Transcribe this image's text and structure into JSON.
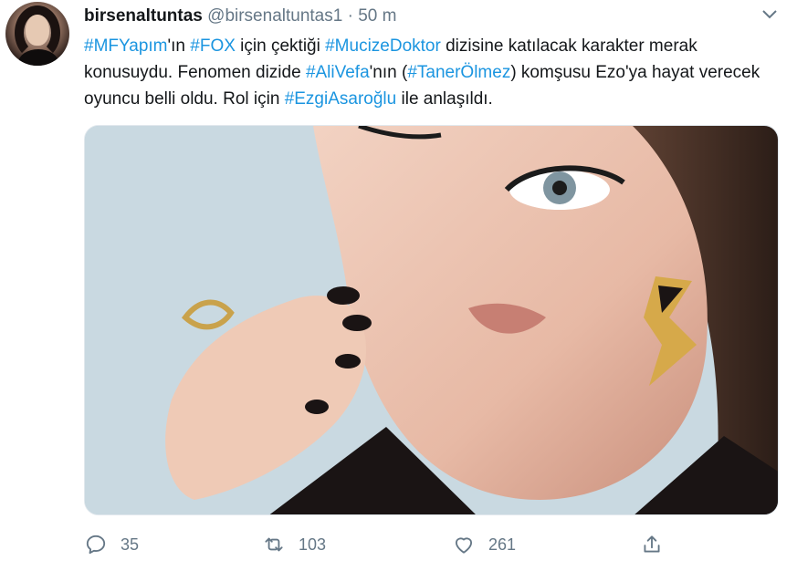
{
  "tweet": {
    "display_name": "birsenaltuntas",
    "handle": "@birsenaltuntas1",
    "separator": "·",
    "time": "50 m",
    "segments": [
      {
        "t": "#MFYapım",
        "tag": true
      },
      {
        "t": "'ın ",
        "tag": false
      },
      {
        "t": "#FOX",
        "tag": true
      },
      {
        "t": " için çektiği ",
        "tag": false
      },
      {
        "t": "#MucizeDoktor",
        "tag": true
      },
      {
        "t": " dizisine katılacak karakter merak konusuydu. Fenomen dizide ",
        "tag": false
      },
      {
        "t": "#AliVefa",
        "tag": true
      },
      {
        "t": "'nın (",
        "tag": false
      },
      {
        "t": "#TanerÖlmez",
        "tag": true
      },
      {
        "t": ") komşusu Ezo'ya hayat verecek oyuncu belli oldu. Rol için ",
        "tag": false
      },
      {
        "t": "#EzgiAsaroğlu",
        "tag": true
      },
      {
        "t": " ile anlaşıldı.",
        "tag": false
      }
    ]
  },
  "actions": {
    "reply_count": "35",
    "retweet_count": "103",
    "like_count": "261"
  },
  "icons": {
    "reply": "reply-icon",
    "retweet": "retweet-icon",
    "like": "heart-icon",
    "share": "share-icon",
    "more": "chevron-down-icon"
  },
  "colors": {
    "hashtag": "#1b95e0",
    "muted": "#657786",
    "text": "#14171a"
  }
}
